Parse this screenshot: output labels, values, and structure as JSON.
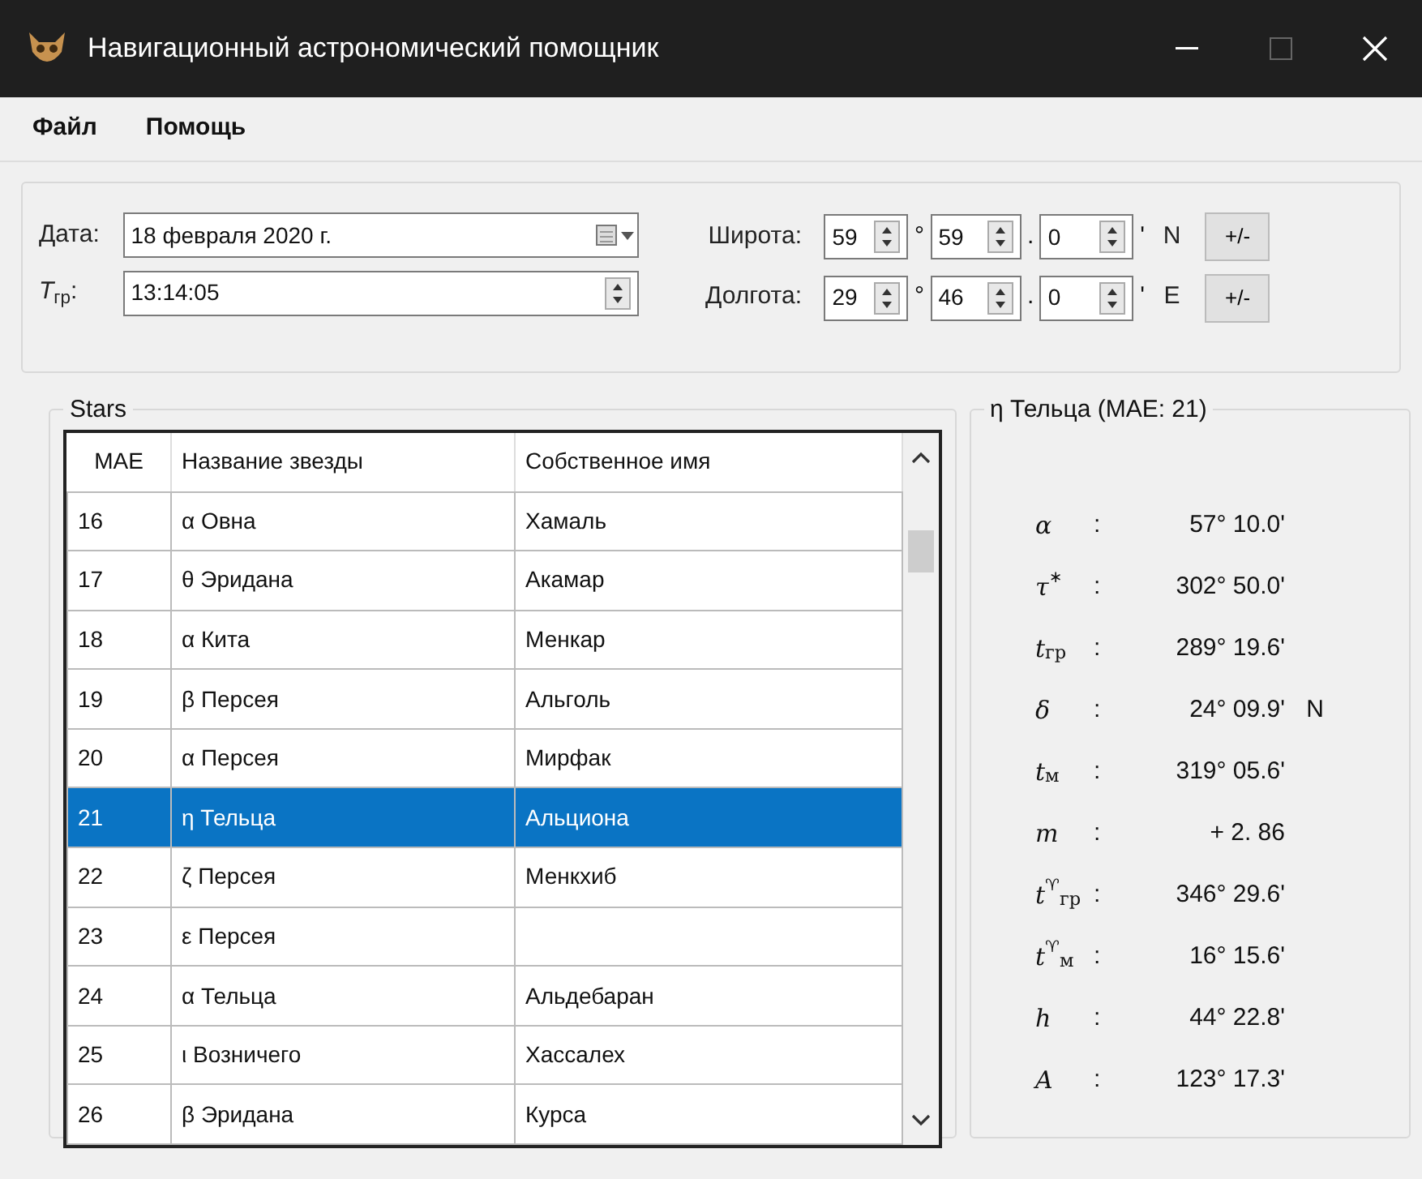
{
  "window": {
    "title": "Навигационный астрономический помощник"
  },
  "menu": [
    "Файл",
    "Помощь"
  ],
  "input_panel": {
    "date": {
      "label": "Дата:",
      "value": "18 февраля  2020 г."
    },
    "time": {
      "label": "*T*$_{гр}$:",
      "value": "13:14:05"
    },
    "coordinates": [
      {
        "label": "Широта:",
        "degrees": "59",
        "degree_sign": "°",
        "minutes": "59",
        "dot": ".",
        "tenths": "0",
        "minute_sign": "'",
        "hemisphere": "N",
        "button": "+/-"
      },
      {
        "label": "Долгота:",
        "degrees": "29",
        "degree_sign": "°",
        "minutes": "46",
        "dot": ".",
        "tenths": "0",
        "minute_sign": "'",
        "hemisphere": "E",
        "button": "+/-"
      }
    ]
  },
  "stars": {
    "title": "Stars",
    "columns": [
      "MAE",
      "Название звезды",
      "Собственное имя"
    ],
    "rows": [
      {
        "number": "16",
        "name": "α Овна",
        "proper_name": "Хамаль",
        "selected": false
      },
      {
        "number": "17",
        "name": "θ Эридана",
        "proper_name": "Акамар",
        "selected": false
      },
      {
        "number": "18",
        "name": "α Кита",
        "proper_name": "Менкар",
        "selected": false
      },
      {
        "number": "19",
        "name": "β Персея",
        "proper_name": "Альголь",
        "selected": false
      },
      {
        "number": "20",
        "name": "α Персея",
        "proper_name": "Мирфак",
        "selected": false
      },
      {
        "number": "21",
        "name": "η Тельца",
        "proper_name": "Альциона",
        "selected": true
      },
      {
        "number": "22",
        "name": "ζ Персея",
        "proper_name": "Менкхиб",
        "selected": false
      },
      {
        "number": "23",
        "name": "ε Персея",
        "selected": false
      },
      {
        "number": "24",
        "name": "α Тельца",
        "proper_name": "Альдебаран",
        "selected": false
      },
      {
        "number": "25",
        "name": "ι Возничего",
        "proper_name": "Хассалех",
        "selected": false
      },
      {
        "number": "26",
        "name": "β Эридана",
        "proper_name": "Курса",
        "selected": false
      }
    ]
  },
  "details": {
    "title": "η Тельца (MAE: 21)",
    "params": [
      {
        "symbol": "*α*",
        "colon": ":",
        "value": "57° 10.0'"
      },
      {
        "symbol": "*τ*$^{∗}$",
        "colon": ":",
        "value": "302° 50.0'"
      },
      {
        "symbol": "*t*$_{гр}$",
        "colon": ":",
        "value": "289° 19.6'"
      },
      {
        "symbol": "*δ*",
        "colon": ":",
        "value": "24° 09.9'",
        "suffix": "N"
      },
      {
        "symbol": "*t*$_{м}$",
        "colon": ":",
        "value": "319° 05.6'"
      },
      {
        "symbol": "*m*",
        "colon": ":",
        "value": "+ 2. 86"
      },
      {
        "symbol": "*t*$^{♈}$$_{гр}$",
        "colon": ":",
        "value": "346° 29.6'"
      },
      {
        "symbol": "*t*$^{♈}$$_{м}$",
        "colon": ":",
        "value": "16° 15.6'"
      },
      {
        "symbol": "*h*",
        "colon": ":",
        "value": "44° 22.8'"
      },
      {
        "symbol": "*A*",
        "colon": ":",
        "value": "123° 17.3'"
      }
    ]
  }
}
